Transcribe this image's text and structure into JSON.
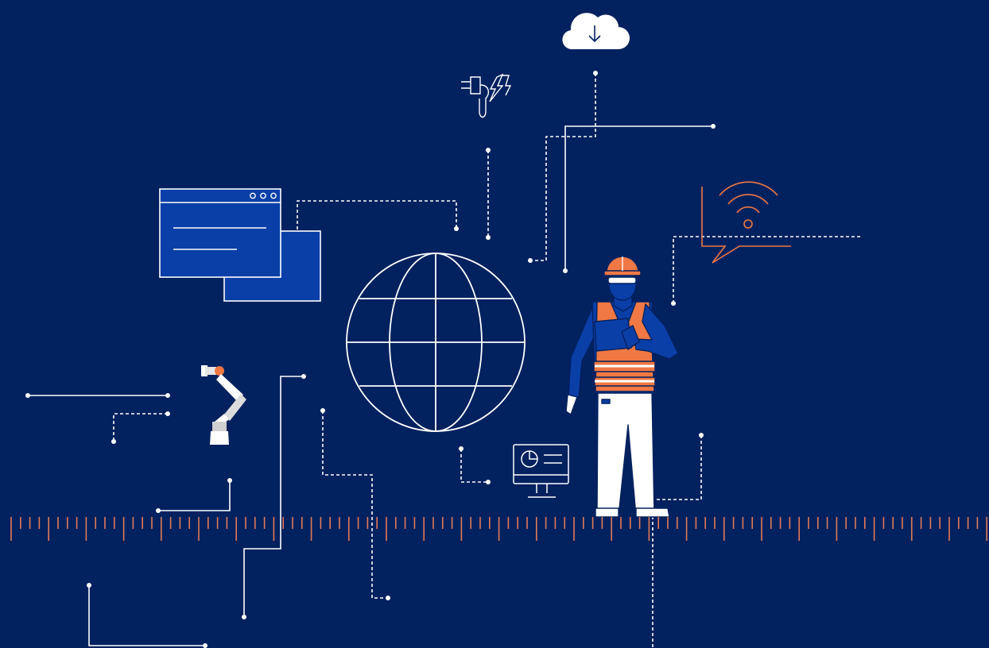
{
  "colors": {
    "background": "#02215f",
    "line": "#ffffff",
    "accent_orange": "#f07844",
    "accent_blue": "#0a3fa8",
    "ruler": "#e27a57"
  },
  "icons": [
    "cloud-download-icon",
    "plug-lightning-icon",
    "browser-window-icon",
    "globe-icon",
    "wifi-speech-bubble-icon",
    "robot-arm-icon",
    "dashboard-monitor-icon",
    "worker-with-tablet-illustration",
    "measurement-ruler"
  ]
}
